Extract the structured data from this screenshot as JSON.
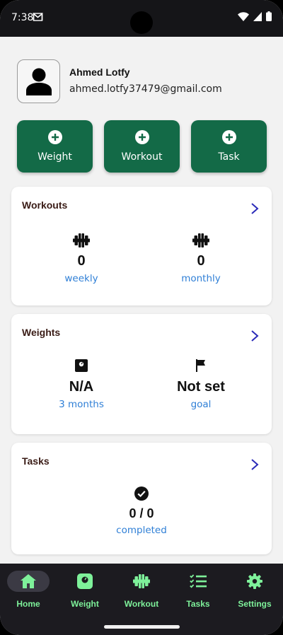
{
  "status_bar": {
    "time": "7:38"
  },
  "profile": {
    "name": "Ahmed Lotfy",
    "email": "ahmed.lotfy37479@gmail.com"
  },
  "quick_actions": [
    {
      "label": "Weight"
    },
    {
      "label": "Workout"
    },
    {
      "label": "Task"
    }
  ],
  "workouts_card": {
    "title": "Workouts",
    "stats": [
      {
        "value": "0",
        "label": "weekly",
        "icon": "dumbbell-icon"
      },
      {
        "value": "0",
        "label": "monthly",
        "icon": "dumbbell-icon"
      }
    ]
  },
  "weights_card": {
    "title": "Weights",
    "stats": [
      {
        "value": "N/A",
        "label": "3 months",
        "icon": "scale-icon"
      },
      {
        "value": "Not set",
        "label": "goal",
        "icon": "flag-icon"
      }
    ]
  },
  "tasks_card": {
    "title": "Tasks",
    "stat": {
      "value": "0 / 0",
      "label": "completed",
      "icon": "check-circle-icon"
    }
  },
  "nav": [
    {
      "label": "Home",
      "icon": "home-icon",
      "active": true
    },
    {
      "label": "Weight",
      "icon": "scale-icon"
    },
    {
      "label": "Workout",
      "icon": "dumbbell-icon"
    },
    {
      "label": "Tasks",
      "icon": "checklist-icon"
    },
    {
      "label": "Settings",
      "icon": "gear-icon"
    }
  ],
  "colors": {
    "brand_green": "#136a47",
    "nav_green": "#7ef19a",
    "link_blue": "#2f7fd6",
    "arrow_blue": "#2a2ab8",
    "nav_background": "#1c1b20"
  }
}
